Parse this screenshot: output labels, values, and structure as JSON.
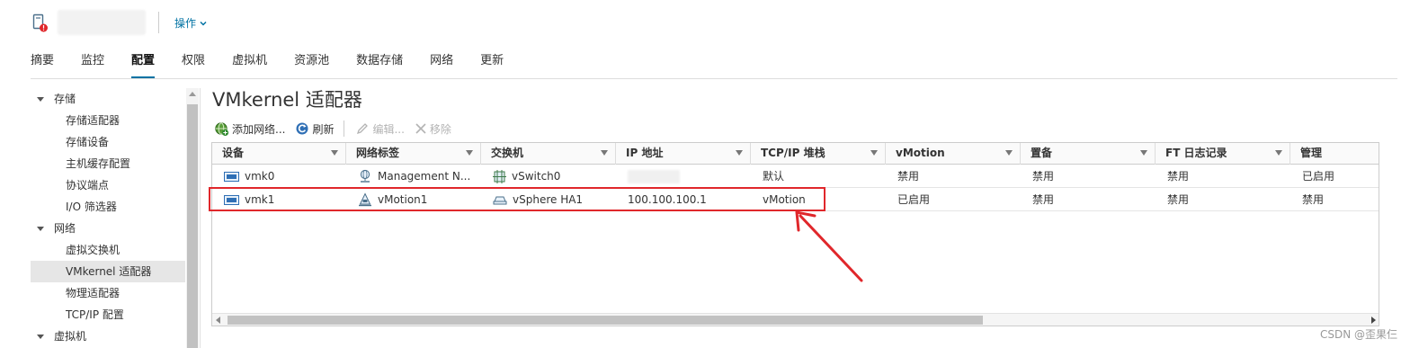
{
  "header": {
    "actions_label": "操作"
  },
  "tabs": [
    {
      "label": "摘要"
    },
    {
      "label": "监控"
    },
    {
      "label": "配置"
    },
    {
      "label": "权限"
    },
    {
      "label": "虚拟机"
    },
    {
      "label": "资源池"
    },
    {
      "label": "数据存储"
    },
    {
      "label": "网络"
    },
    {
      "label": "更新"
    }
  ],
  "active_tab": "配置",
  "tree": [
    {
      "label": "存储",
      "type": "group",
      "expanded": true
    },
    {
      "label": "存储适配器",
      "type": "child"
    },
    {
      "label": "存储设备",
      "type": "child"
    },
    {
      "label": "主机缓存配置",
      "type": "child"
    },
    {
      "label": "协议端点",
      "type": "child"
    },
    {
      "label": "I/O 筛选器",
      "type": "child"
    },
    {
      "label": "网络",
      "type": "group",
      "expanded": true
    },
    {
      "label": "虚拟交换机",
      "type": "child"
    },
    {
      "label": "VMkernel 适配器",
      "type": "child",
      "selected": true
    },
    {
      "label": "物理适配器",
      "type": "child"
    },
    {
      "label": "TCP/IP 配置",
      "type": "child"
    },
    {
      "label": "虚拟机",
      "type": "group",
      "expanded": true
    }
  ],
  "panel": {
    "title": "VMkernel 适配器"
  },
  "toolbar": {
    "add_label": "添加网络...",
    "refresh_label": "刷新",
    "edit_label": "编辑...",
    "remove_label": "移除"
  },
  "table": {
    "columns": [
      "设备",
      "网络标签",
      "交换机",
      "IP 地址",
      "TCP/IP 堆栈",
      "vMotion",
      "置备",
      "FT 日志记录",
      "管理"
    ],
    "rows": [
      {
        "device": "vmk0",
        "network_label": "Management N...",
        "switch": "vSwitch0",
        "ip": "",
        "tcpip_stack": "默认",
        "vmotion": "禁用",
        "provisioning": "禁用",
        "ft_logging": "禁用",
        "management": "已启用"
      },
      {
        "device": "vmk1",
        "network_label": "vMotion1",
        "switch": "vSphere HA1",
        "ip": "100.100.100.1",
        "tcpip_stack": "vMotion",
        "vmotion": "已启用",
        "provisioning": "禁用",
        "ft_logging": "禁用",
        "management": "禁用"
      }
    ]
  },
  "annotation": {
    "color": "#e0272b"
  },
  "colors": {
    "accent": "#0072a3",
    "alert": "#e0272b"
  },
  "watermark": "CSDN @歪果仨"
}
